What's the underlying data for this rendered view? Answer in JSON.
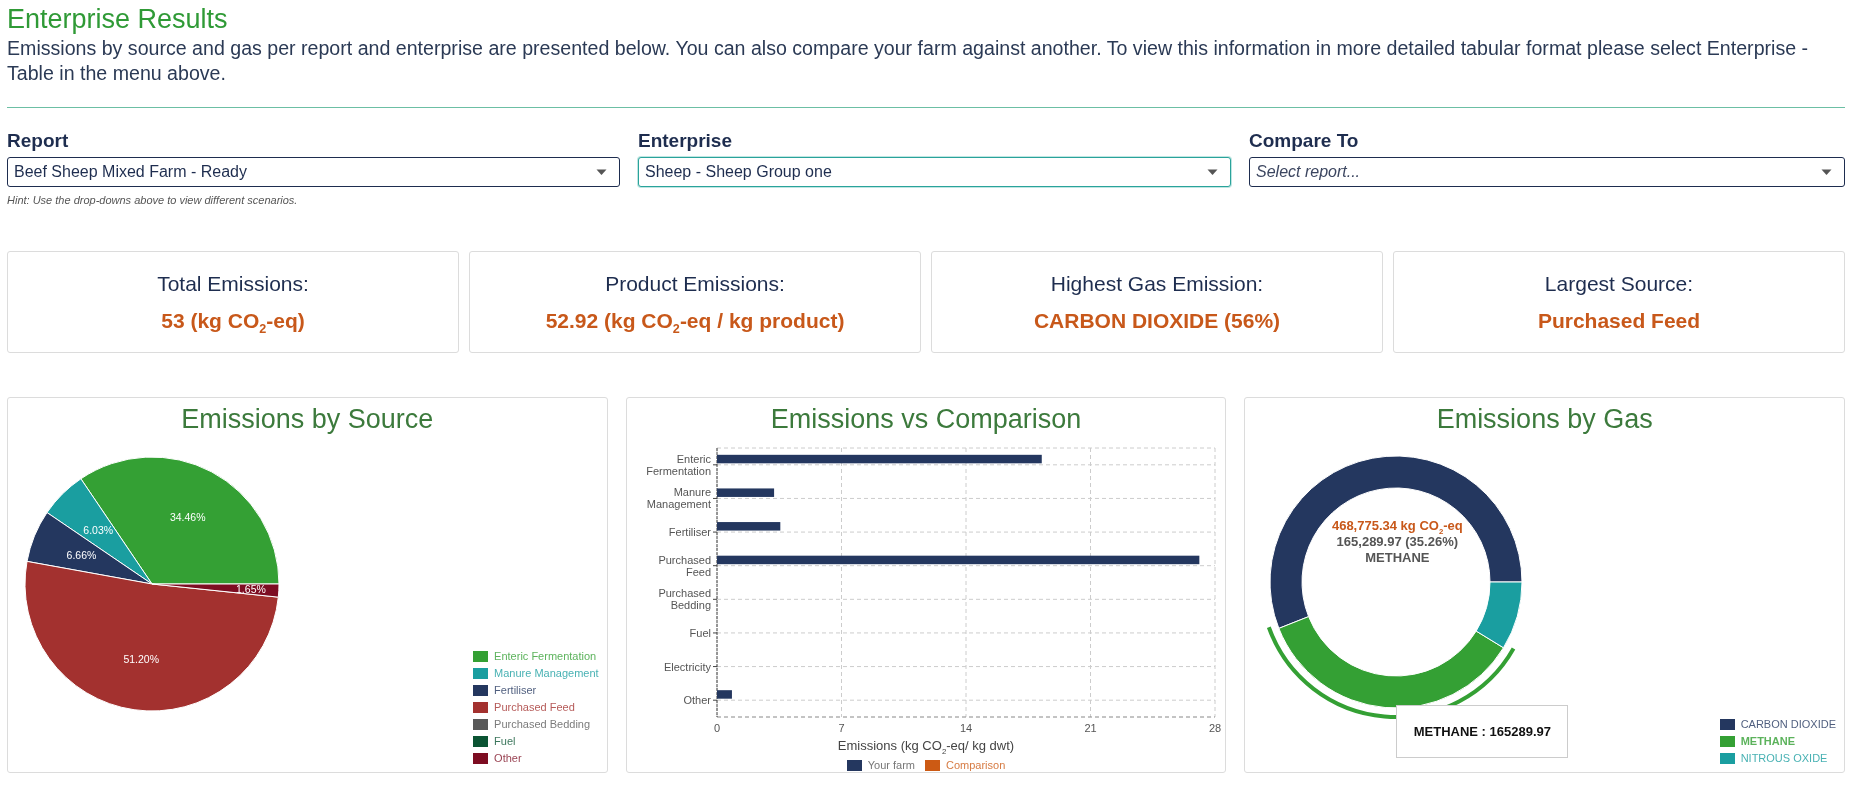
{
  "page": {
    "title": "Enterprise Results",
    "description": "Emissions by source and gas per report and enterprise are presented below. You can also compare your farm against another. To view this information in more detailed tabular format please select Enterprise - Table in the menu above."
  },
  "filters": [
    {
      "label": "Report",
      "value": "Beef Sheep Mixed Farm - Ready",
      "focused": false
    },
    {
      "label": "Enterprise",
      "value": "Sheep - Sheep Group one",
      "focused": true
    },
    {
      "label": "Compare To",
      "placeholder": "Select report...",
      "focused": false
    }
  ],
  "hint": "Hint: Use the drop-downs above to view different scenarios.",
  "summary_cards": [
    {
      "label": "Total Emissions:",
      "value": "53 (kg CO$_{2}$-eq)"
    },
    {
      "label": "Product Emissions:",
      "value": "52.92 (kg CO$_{2}$-eq / kg product)"
    },
    {
      "label": "Highest Gas Emission:",
      "value": "CARBON DIOXIDE (56%)"
    },
    {
      "label": "Largest Source:",
      "value": "Purchased Feed"
    }
  ],
  "charts": [
    {
      "chart_data": {
        "type": "pie",
        "title": "Emissions by Source",
        "categories": [
          "Enteric Fermentation",
          "Manure Management",
          "Fertiliser",
          "Purchased Feed",
          "Purchased Bedding",
          "Fuel",
          "Other"
        ],
        "values": [
          34.46,
          6.03,
          6.66,
          51.2,
          0,
          0,
          1.65
        ],
        "value_labels": [
          "34.46%",
          "6.03%",
          "6.66%",
          "51.20%",
          null,
          null,
          "1.65%"
        ]
      },
      "legend": [
        {
          "color": "#34a034"
        },
        {
          "color": "#1a9ea0"
        },
        {
          "color": "#24375f"
        },
        {
          "color": "#a3312f"
        },
        {
          "color": "#595959"
        },
        {
          "color": "#0b5433"
        },
        {
          "color": "#7d0d22"
        }
      ]
    },
    {
      "chart_data": {
        "type": "bar",
        "title": "Emissions vs Comparison",
        "orientation": "horizontal",
        "grid": true,
        "xlabel": "Emissions (kg CO$_{2}$-eq/ kg dwt)",
        "categories": [
          "Enteric Fermentation",
          "Manure Management",
          "Fertiliser",
          "Purchased Feed",
          "Purchased Bedding",
          "Fuel",
          "Electricity",
          "Other"
        ],
        "xlim": [
          0,
          28
        ],
        "xticks": [
          0,
          7,
          14,
          21,
          28
        ],
        "series": [
          {
            "name": "Your farm",
            "color": "#24375f",
            "values": [
              18.26,
              3.21,
              3.56,
              27.12,
              0,
              0,
              0,
              0.84
            ]
          },
          {
            "name": "Comparison",
            "color": "#cc5a14",
            "values": [
              null,
              null,
              null,
              null,
              null,
              null,
              null,
              null
            ]
          }
        ]
      }
    },
    {
      "chart_data": {
        "type": "donut",
        "title": "Emissions by Gas",
        "categories": [
          "CARBON DIOXIDE",
          "METHANE",
          "NITROUS OXIDE"
        ],
        "values": [
          56,
          35.26,
          8.74
        ]
      },
      "center": {
        "total": "468,775.34 kg CO$_{2}$-eq",
        "value": "165,289.97 (35.26%)",
        "label": "METHANE"
      },
      "tooltip": "METHANE : 165289.97",
      "legend": [
        {
          "color": "#24375f",
          "selected": false
        },
        {
          "color": "#34a034",
          "selected": true
        },
        {
          "color": "#1a9ea0",
          "selected": false
        }
      ]
    }
  ]
}
